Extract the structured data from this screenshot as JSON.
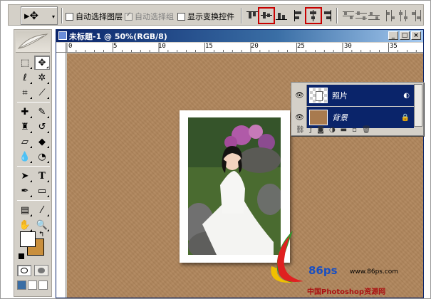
{
  "options_bar": {
    "auto_select_layer": "自动选择图层",
    "auto_select_group": "自动选择组",
    "show_transform_controls": "显示变换控件"
  },
  "document": {
    "title": "未标题-1 @ 50%(RGB/8)",
    "ruler_labels": [
      "0",
      "5",
      "10",
      "15",
      "20",
      "25",
      "30",
      "35"
    ]
  },
  "layers": {
    "items": [
      {
        "name": "照片"
      },
      {
        "name": "背景"
      }
    ]
  },
  "watermark": {
    "logo_text": "86ps",
    "url": "www.86ps.com",
    "caption": "中国Photoshop资源网"
  },
  "colors": {
    "canvas_bg": "#b0865c",
    "fg_color": "#ffffff",
    "bg_color": "#c98f3d",
    "selection_blue": "#0a246a",
    "highlight_red": "#c80000"
  }
}
